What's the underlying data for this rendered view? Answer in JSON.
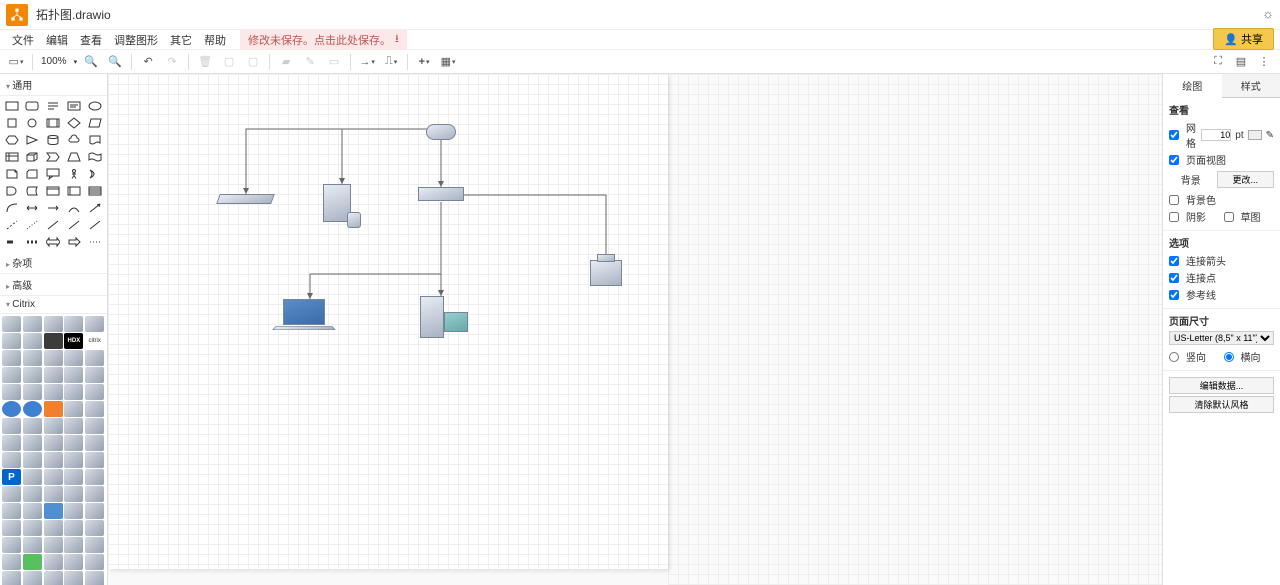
{
  "title": "拓扑图.drawio",
  "menu": {
    "file": "文件",
    "edit": "编辑",
    "view": "查看",
    "arrange": "调整图形",
    "extras": "其它",
    "help": "帮助"
  },
  "unsaved_msg": "修改未保存。点击此处保存。",
  "share_label": "共享",
  "zoom": "100%",
  "sidebar": {
    "general": "通用",
    "misc": "杂项",
    "advanced": "高级",
    "citrix": "Citrix",
    "hdx": "HDX"
  },
  "right": {
    "tab_diagram": "绘图",
    "tab_style": "样式",
    "view": "查看",
    "grid": "网格",
    "grid_size": "10",
    "grid_unit": "pt",
    "page_view": "页面视图",
    "background": "背景",
    "change": "更改...",
    "bgcolor": "背景色",
    "shadow": "阴影",
    "sketch": "草图",
    "options": "选项",
    "conn_arrows": "连接箭头",
    "conn_points": "连接点",
    "guides": "参考线",
    "page_size": "页面尺寸",
    "paper": "US-Letter (8,5\" x 11\")",
    "portrait": "竖向",
    "landscape": "横向",
    "edit_data": "编辑数据...",
    "clear_style": "清除默认风格"
  }
}
